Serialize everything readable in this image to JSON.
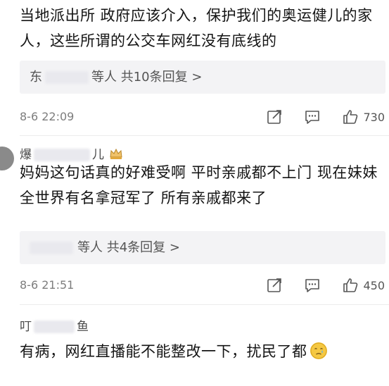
{
  "comments": [
    {
      "name_prefix": "",
      "name_suffix": "",
      "text": "当地派出所 政府应该介入，保护我们的奥运健儿的家人，这些所谓的公交车网红没有底线的",
      "reply_prefix": "东",
      "reply_label": "等人 共10条回复 >",
      "time": "8-6 22:09",
      "likes": "730"
    },
    {
      "name_prefix": "爆",
      "name_suffix": "儿",
      "text": "妈妈这句话真的好难受啊 平时亲戚都不上门 现在妹妹全世界有名拿冠军了 所有亲戚都来了",
      "reply_prefix": "",
      "reply_label": "等人 共4条回复 >",
      "time": "8-6 21:51",
      "likes": "450"
    },
    {
      "name_prefix": "叮",
      "name_suffix": "鱼",
      "text": "有病，网红直播能不能整改一下，扰民了都",
      "reply_prefix": "",
      "reply_label": "",
      "time": "",
      "likes": ""
    }
  ],
  "icons": {
    "share": "share-icon",
    "comment": "comment-icon",
    "like": "thumbs-up-icon",
    "badge": "crown-badge-icon",
    "emoji": "crying-emoji-icon"
  },
  "colors": {
    "text": "#141414",
    "meta": "#7d7d7d",
    "reply_bg": "#f3f3f5"
  }
}
